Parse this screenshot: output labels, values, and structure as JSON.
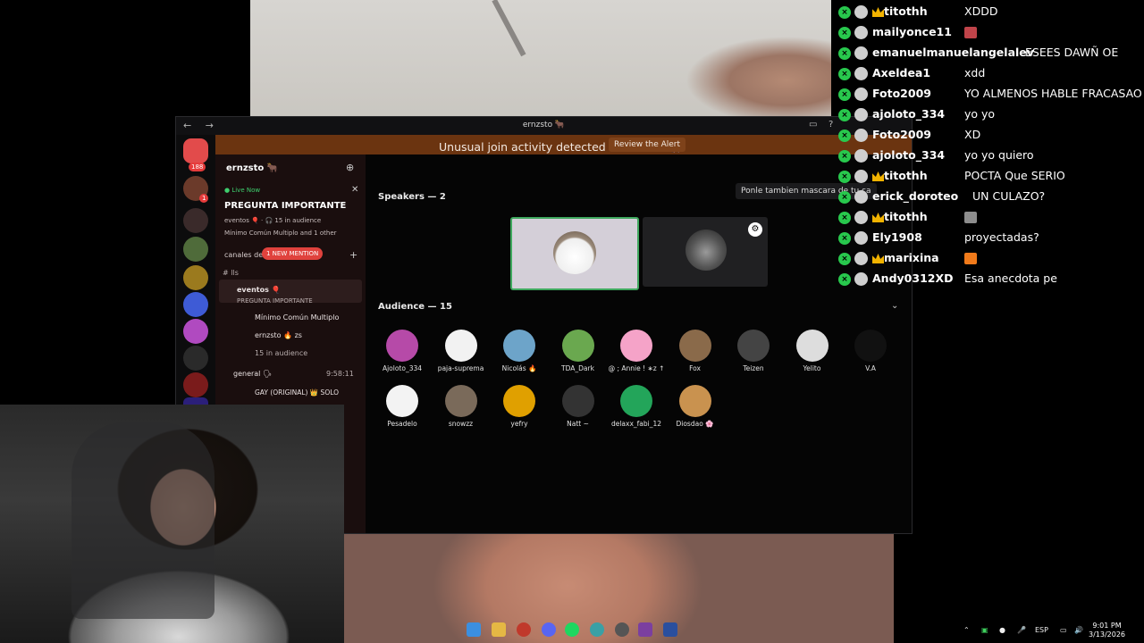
{
  "discord": {
    "window_title": "ernzsto 🐂",
    "nav_arrows": "← →",
    "alert": {
      "message": "Unusual join activity detected in ernzsto 🐂",
      "button": "Review the Alert"
    },
    "rail_badges": {
      "dms": "188",
      "server": "1"
    },
    "server_name": "ernzsto 🐂",
    "live": {
      "tag": "● Live Now",
      "title": "PREGUNTA IMPORTANTE",
      "line1": "eventos 🎈 · 🎧 15 in audience",
      "line2": "Mínimo Común Multiplo and 1 other"
    },
    "category": "canales de",
    "new_mention": "1 NEW MENTION",
    "channels": [
      {
        "name": "# lls"
      },
      {
        "name": "eventos 🎈",
        "sub": "PREGUNTA IMPORTANTE"
      },
      {
        "name": "Mínimo Común Multiplo"
      },
      {
        "name": "ernzsto 🔥 zs"
      },
      {
        "name": "15 in audience"
      },
      {
        "name": "general 🗣",
        "time": "9:58:11"
      },
      {
        "name": "GAY (ORIGINAL) 👑 SOLO"
      }
    ],
    "stage": {
      "speakers_title": "Speakers — 2",
      "tooltip": "Ponle tambien mascara de tu ca",
      "audience_title": "Audience — 15",
      "audience": [
        {
          "name": "Ajoloto_334",
          "color": "#b64aa8"
        },
        {
          "name": "paja-suprema",
          "color": "#f2f2f2"
        },
        {
          "name": "Nicolás 🔥",
          "color": "#6da4c9"
        },
        {
          "name": "TDA_Dark",
          "color": "#6aa84f"
        },
        {
          "name": "@ ; Annie ! ∗z ↑",
          "color": "#f5a3c8"
        },
        {
          "name": "Fox",
          "color": "#8a6a4a"
        },
        {
          "name": "Teizen",
          "color": "#444"
        },
        {
          "name": "Yelito",
          "color": "#ddd"
        },
        {
          "name": "V.A",
          "color": "#111"
        },
        {
          "name": "Pesadelo",
          "color": "#f3f3f3"
        },
        {
          "name": "snowzz",
          "color": "#7a6a5a"
        },
        {
          "name": "yefry",
          "color": "#e0a000"
        },
        {
          "name": "Natt ~",
          "color": "#333"
        },
        {
          "name": "delaxx_fabi_12",
          "color": "#23a55a"
        },
        {
          "name": "Diosdao 🌸",
          "color": "#c9924f"
        }
      ]
    }
  },
  "chat": [
    {
      "user": "titothh",
      "text": "XDDD",
      "crown": true,
      "emote": ""
    },
    {
      "user": "mailyonce11",
      "text": "",
      "crown": false,
      "emote": "#c0444a"
    },
    {
      "user": "emanuelmanuelangelalev",
      "text": "ESEES DAWÑ OE",
      "crown": false,
      "emote": ""
    },
    {
      "user": "Axeldea1",
      "text": "xdd",
      "crown": false,
      "emote": ""
    },
    {
      "user": "Foto2009",
      "text": "YO ALMENOS HABLE FRACASAO",
      "crown": false,
      "emote": ""
    },
    {
      "user": "ajoloto_334",
      "text": "yo yo",
      "crown": false,
      "emote": ""
    },
    {
      "user": "Foto2009",
      "text": "XD",
      "crown": false,
      "emote": ""
    },
    {
      "user": "ajoloto_334",
      "text": "yo yo quiero",
      "crown": false,
      "emote": ""
    },
    {
      "user": "titothh",
      "text": "POCTA Que SERIO",
      "crown": true,
      "emote": ""
    },
    {
      "user": "erick_doroteo",
      "text": "UN CULAZO?",
      "crown": false,
      "emote": ""
    },
    {
      "user": "titothh",
      "text": "",
      "crown": true,
      "emote": "#8d8d8d"
    },
    {
      "user": "Ely1908",
      "text": "proyectadas?",
      "crown": false,
      "emote": ""
    },
    {
      "user": "marixina",
      "text": "",
      "crown": true,
      "emote": "#f07a1a"
    },
    {
      "user": "Andy0312XD",
      "text": "Esa anecdota pe",
      "crown": false,
      "emote": ""
    }
  ],
  "taskbar": {
    "tray_lang": "ESP",
    "time": "9:01 PM",
    "date": "3/13/2026"
  }
}
